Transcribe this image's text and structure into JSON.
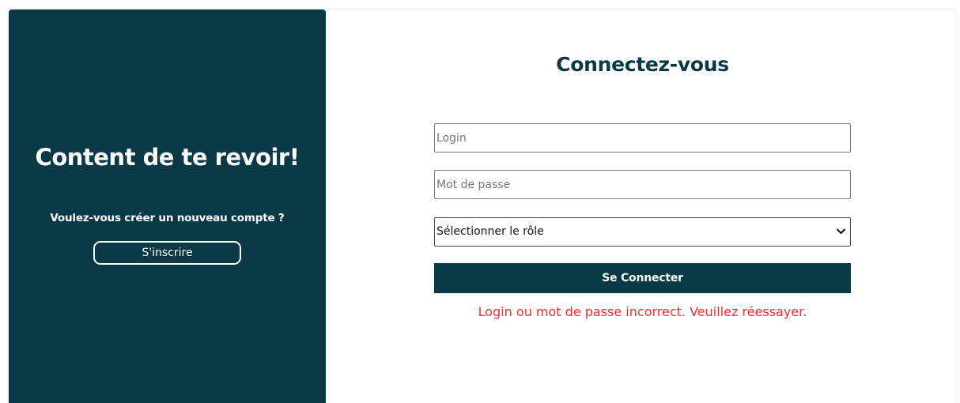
{
  "left_panel": {
    "welcome_title": "Content de te revoir!",
    "signup_question": "Voulez-vous créer un nouveau compte ?",
    "signup_button_label": "S'inscrire",
    "background_color": "#083945"
  },
  "login_form": {
    "title": "Connectez-vous",
    "login_placeholder": "Login",
    "password_placeholder": "Mot de passe",
    "role_select_value": "Sélectionner le rôle",
    "submit_label": "Se Connecter",
    "error_message": "Login ou mot de passe incorrect. Veuillez réessayer.",
    "accent_color": "#083945",
    "error_color": "#ef2d2d",
    "select_icon": "chevron-down-icon"
  }
}
